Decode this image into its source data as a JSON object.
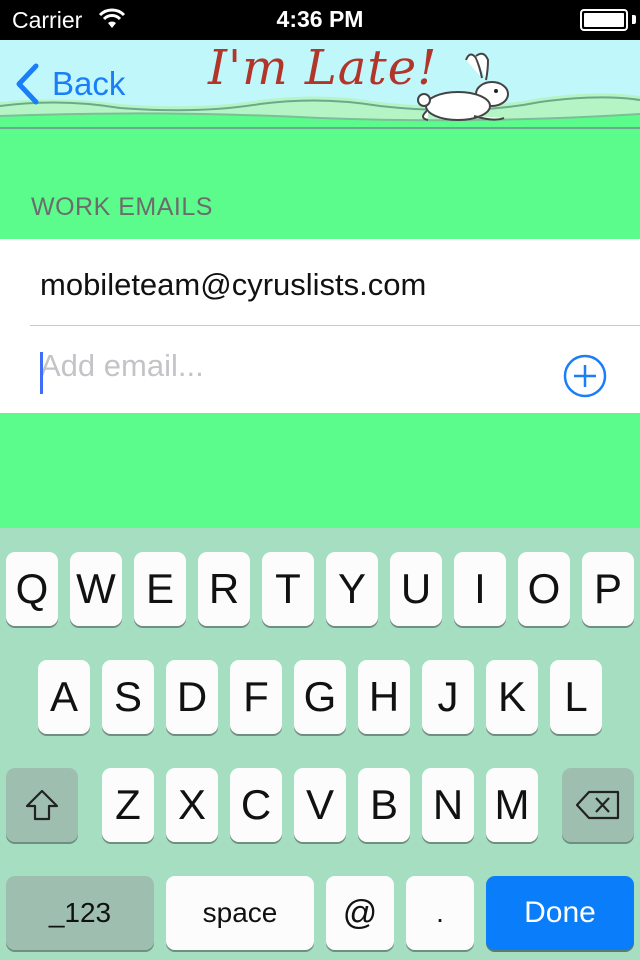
{
  "status_bar": {
    "carrier": "Carrier",
    "time": "4:36 PM"
  },
  "nav": {
    "back_label": "Back",
    "title": "I'm Late!"
  },
  "section": {
    "header": "WORK EMAILS"
  },
  "emails": {
    "items": [
      "mobileteam@cyruslists.com"
    ],
    "add_placeholder": "Add email..."
  },
  "keyboard": {
    "row1": [
      "Q",
      "W",
      "E",
      "R",
      "T",
      "Y",
      "U",
      "I",
      "O",
      "P"
    ],
    "row2": [
      "A",
      "S",
      "D",
      "F",
      "G",
      "H",
      "J",
      "K",
      "L"
    ],
    "row3": [
      "Z",
      "X",
      "C",
      "V",
      "B",
      "N",
      "M"
    ],
    "numbers_label": "_123",
    "space_label": "space",
    "at_label": "@",
    "dot_label": ".",
    "done_label": "Done"
  },
  "colors": {
    "background": "#5cfc8c",
    "accent": "#1a7ef8",
    "keyboard": "#a6dec2",
    "done_key": "#0a7dfb",
    "title": "#b2352a"
  }
}
